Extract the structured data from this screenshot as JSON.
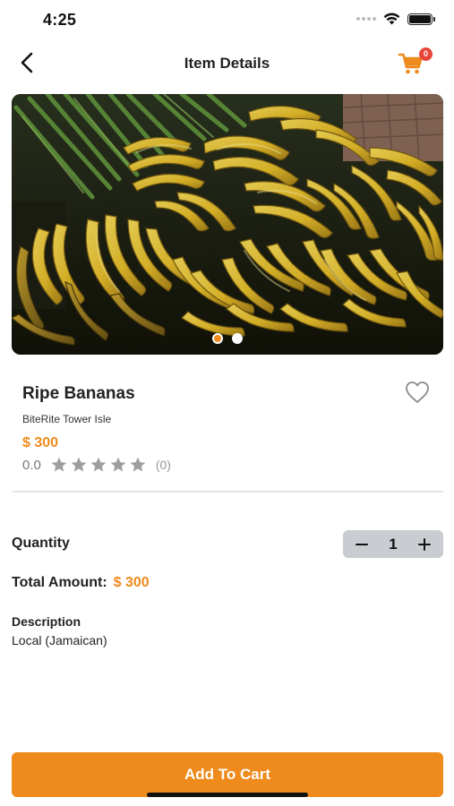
{
  "status_bar": {
    "time": "4:25"
  },
  "header": {
    "title": "Item Details",
    "cart_count": "0"
  },
  "carousel": {
    "total_images": 2,
    "active_index": 0
  },
  "product": {
    "name": "Ripe Bananas",
    "store": "BiteRite Tower Isle",
    "price": "$ 300",
    "rating_value": "0.0",
    "rating_stars": 5,
    "rating_filled": 0,
    "rating_count": "(0)"
  },
  "quantity": {
    "label": "Quantity",
    "value": "1"
  },
  "total": {
    "label": "Total Amount:",
    "value": "$ 300"
  },
  "description": {
    "label": "Description",
    "text": "Local (Jamaican)"
  },
  "actions": {
    "add_to_cart": "Add To Cart"
  },
  "icons": {
    "back": "chevron-left-icon",
    "cart": "shopping-cart-icon",
    "favorite": "heart-outline-icon",
    "star": "star-icon",
    "minus": "minus-icon",
    "plus": "plus-icon"
  },
  "colors": {
    "accent": "#ef8a1c",
    "badge": "#e8453c",
    "stepper_bg": "#c9ccd1",
    "star_inactive": "#9e9e9e"
  }
}
